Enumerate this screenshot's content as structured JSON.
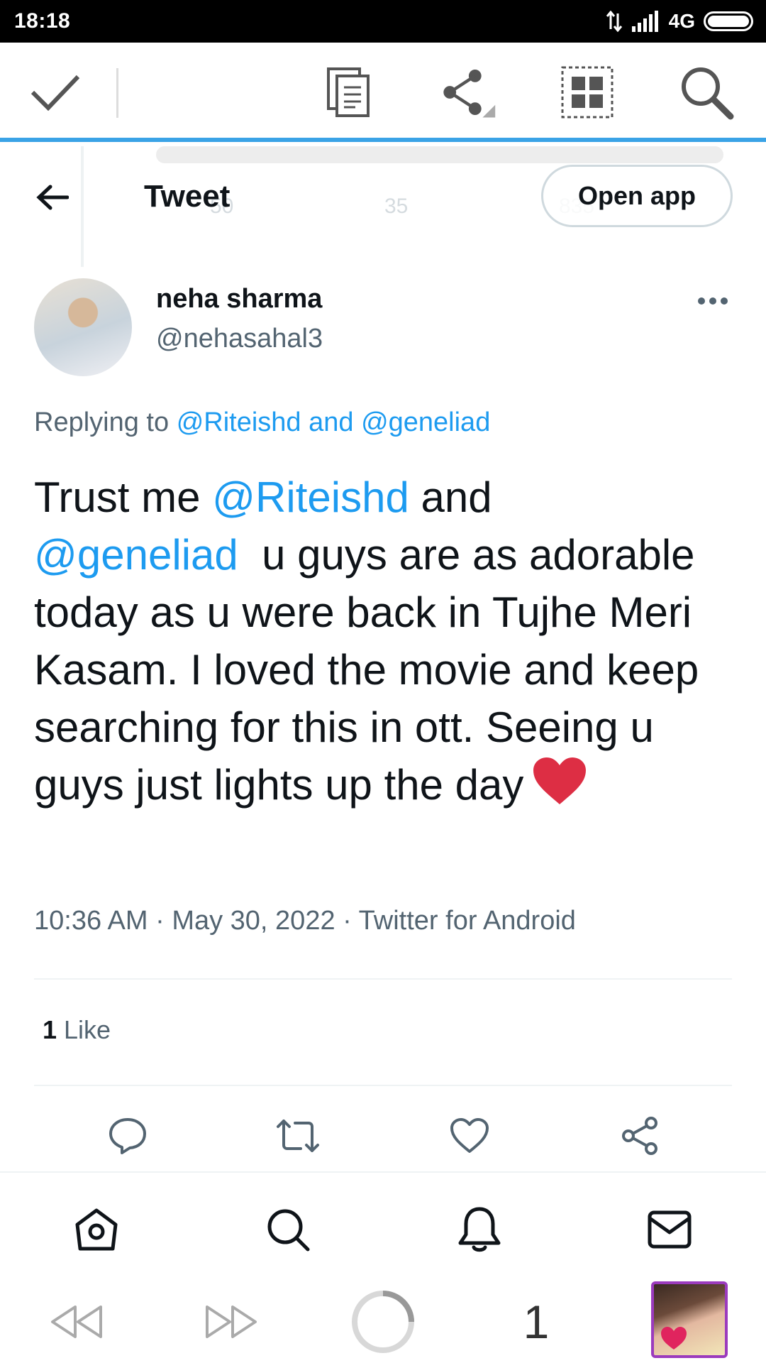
{
  "status_bar": {
    "time": "18:18",
    "network": "4G"
  },
  "header": {
    "title": "Tweet",
    "open_app_label": "Open app"
  },
  "background_stats": {
    "reply_count": "50",
    "retweet_count": "35",
    "like_count": "835"
  },
  "author": {
    "name": "neha sharma",
    "handle": "@nehasahal3"
  },
  "replying_to": {
    "prefix": "Replying to",
    "mentions": "@Riteishd and @geneliad"
  },
  "tweet": {
    "part1": "Trust me ",
    "mention1": "@Riteishd",
    "part2": " and",
    "mention2": "@geneliad",
    "part3": "  u guys are as adorable today as u were back in Tujhe Meri Kasam. I loved the movie and keep searching for this in ott. Seeing u guys just lights up the day"
  },
  "meta": "10:36 AM · May 30, 2022 · Twitter for Android",
  "likes": {
    "count": "1",
    "label": " Like"
  },
  "browser": {
    "tab_count": "1"
  },
  "colors": {
    "accent": "#1d9bf0",
    "toolbar_line": "#3aa3e6",
    "heart": "#e0245e"
  }
}
